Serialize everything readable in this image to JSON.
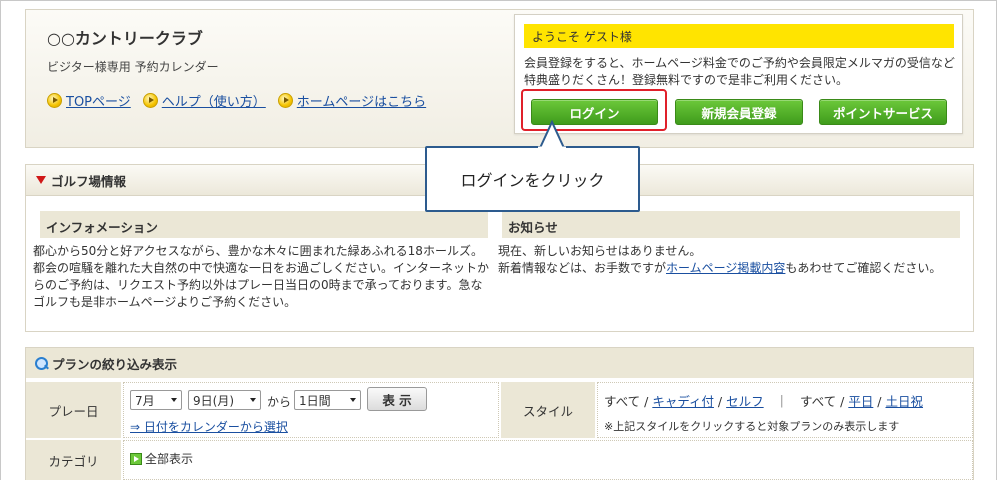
{
  "header": {
    "club_name": "○○カントリークラブ",
    "subtitle": "ビジター様専用 予約カレンダー",
    "links": [
      "TOPページ",
      "ヘルプ（使い方）",
      "ホームページはこちら"
    ]
  },
  "welcome": {
    "title": "ようこそ ゲスト様",
    "text": "会員登録をすると、ホームページ料金でのご予約や会員限定メルマガの受信など特典盛りだくさん！登録無料ですので是非ご利用ください。",
    "login_label": "ログイン",
    "register_label": "新規会員登録",
    "points_label": "ポイントサービス"
  },
  "callout": {
    "text": "ログインをクリック"
  },
  "golf": {
    "title": "ゴルフ場情報",
    "info_title": "インフォメーション",
    "info_text": "都心から50分と好アクセスながら、豊かな木々に囲まれた緑あふれる18ホールズ。都会の喧騒を離れた大自然の中で快適な一日をお過ごしください。インターネットからのご予約は、リクエスト予約以外はプレー日当日の0時まで承っております。急なゴルフも是非ホームページよりご予約ください。",
    "news_title": "お知らせ",
    "news_line1": "現在、新しいお知らせはありません。",
    "news_line2_pre": "新着情報などは、お手数ですが",
    "news_link": "ホームページ掲載内容",
    "news_line2_post": "もあわせてご確認ください。"
  },
  "plan": {
    "title": "プランの絞り込み表示",
    "play_date_label": "プレー日",
    "month": "7月",
    "day": "9日(月)",
    "from_label": "から",
    "range": "1日間",
    "show_label": "表 示",
    "calendar_link": "⇒ 日付をカレンダーから選択",
    "style_label": "スタイル",
    "style_all1": "すべて",
    "style_caddie": "キャディ付",
    "style_self": "セルフ",
    "style_divider": "｜",
    "style_all2": "すべて",
    "style_weekday": "平日",
    "style_holiday": "土日祝",
    "style_note": "※上記スタイルをクリックすると対象プランのみ表示します",
    "category_label": "カテゴリ",
    "category_all": "全部表示"
  }
}
